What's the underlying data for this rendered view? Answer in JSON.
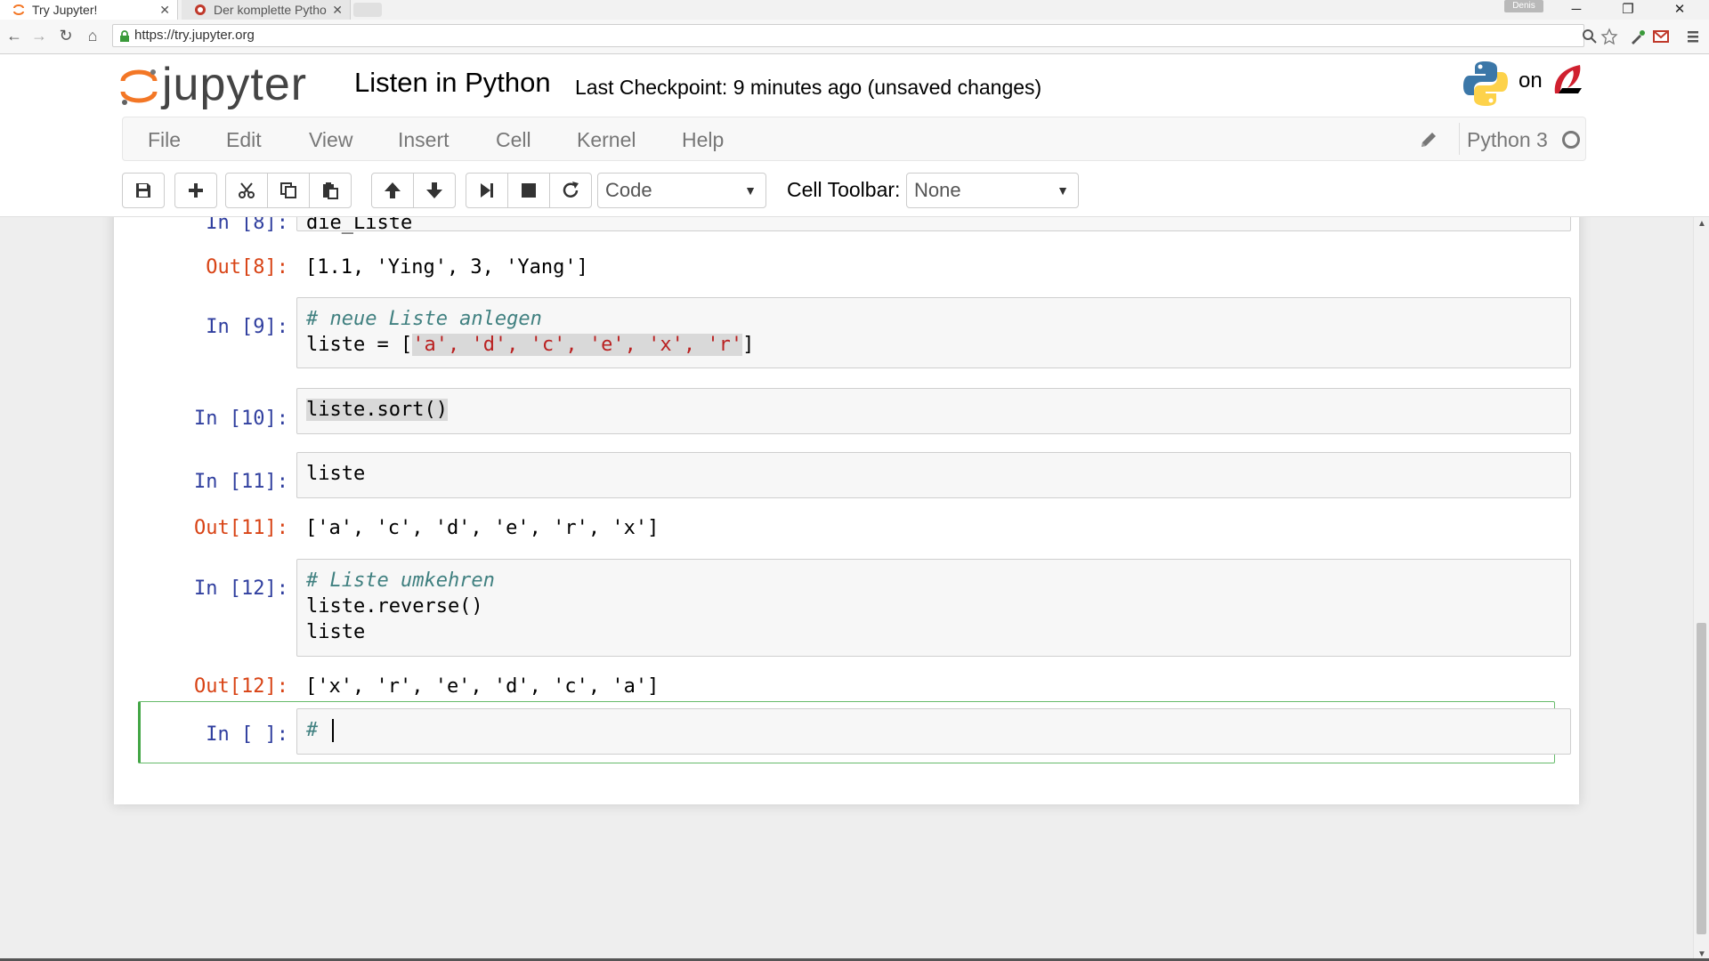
{
  "browser": {
    "tabs": [
      {
        "label": "Try Jupyter!",
        "active": true
      },
      {
        "label": "Der komplette Pytho",
        "active": false
      }
    ],
    "profile_name": "Denis",
    "url": "https://try.jupyter.org"
  },
  "header": {
    "logo_text": "jupyter",
    "notebook_title": "Listen in Python",
    "checkpoint": "Last Checkpoint: 9 minutes ago (unsaved changes)",
    "on_text": "on"
  },
  "menubar": {
    "items": [
      "File",
      "Edit",
      "View",
      "Insert",
      "Cell",
      "Kernel",
      "Help"
    ],
    "kernel_name": "Python 3"
  },
  "toolbar": {
    "cell_type": "Code",
    "cell_toolbar_label": "Cell Toolbar:",
    "cell_toolbar_value": "None",
    "buttons": [
      "save-icon",
      "plus-icon",
      "cut-icon",
      "copy-icon",
      "paste-icon",
      "arrow-up-icon",
      "arrow-down-icon",
      "step-forward-icon",
      "stop-icon",
      "refresh-icon"
    ]
  },
  "cells": {
    "c8": {
      "in_prompt": "In [8]:",
      "code": "die_Liste",
      "out_prompt": "Out[8]:",
      "output": "[1.1, 'Ying', 3, 'Yang']"
    },
    "c9": {
      "in_prompt": "In [9]:",
      "comment": "# neue Liste anlegen",
      "code_prefix": "liste = [",
      "code_strings": "'a', 'd', 'c', 'e', 'x', 'r'",
      "code_suffix": "]"
    },
    "c10": {
      "in_prompt": "In [10]:",
      "code": "liste.sort()"
    },
    "c11": {
      "in_prompt": "In [11]:",
      "code": "liste",
      "out_prompt": "Out[11]:",
      "output": "['a', 'c', 'd', 'e', 'r', 'x']"
    },
    "c12": {
      "in_prompt": "In [12]:",
      "comment": "# Liste umkehren",
      "code_line2": "liste.reverse()",
      "code_line3": "liste",
      "out_prompt": "Out[12]:",
      "output": "['x', 'r', 'e', 'd', 'c', 'a']"
    },
    "c_new": {
      "in_prompt": "In [ ]:",
      "code": "# "
    }
  },
  "colors": {
    "in_prompt": "#303f9f",
    "out_prompt": "#d84315",
    "comment": "#408080",
    "string": "#ba2121",
    "selected_border": "#66bb6a"
  }
}
